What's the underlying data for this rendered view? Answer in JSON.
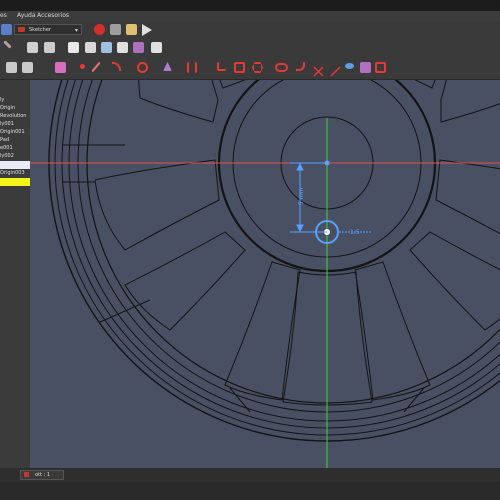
{
  "menu": {
    "items": [
      "es",
      "Ayuda",
      "Accesorios"
    ]
  },
  "toolbar": {
    "workbench": "Sketcher"
  },
  "tree": {
    "items": [
      "ly",
      "Origin",
      "Revolution",
      "ly001",
      "Origin001",
      "Pad",
      "e001",
      "ly002",
      "",
      "Origin003",
      ""
    ]
  },
  "tabs": {
    "active": "ott : 1"
  },
  "sketch": {
    "dim_vertical": "5 mm",
    "dim_horizontal": "1.5"
  },
  "colors": {
    "viewport_bg": "#4a5063",
    "x_axis": "#e05050",
    "y_axis": "#3fd03f",
    "dimension": "#5aa0ff",
    "selection": "#f4f418"
  }
}
